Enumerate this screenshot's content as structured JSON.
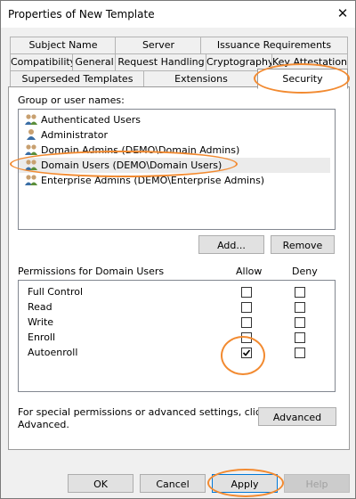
{
  "window": {
    "title": "Properties of New Template",
    "close_glyph": "✕"
  },
  "tabs": {
    "row1": [
      "Subject Name",
      "Server",
      "Issuance Requirements"
    ],
    "row2": [
      "Compatibility",
      "General",
      "Request Handling",
      "Cryptography",
      "Key Attestation"
    ],
    "row3": [
      "Superseded Templates",
      "Extensions",
      "Security"
    ],
    "active": "Security"
  },
  "security": {
    "group_label": "Group or user names:",
    "users": [
      {
        "name": "Authenticated Users",
        "icon": "group-icon"
      },
      {
        "name": "Administrator",
        "icon": "user-icon"
      },
      {
        "name": "Domain Admins (DEMO\\Domain Admins)",
        "icon": "group-icon"
      },
      {
        "name": "Domain Users (DEMO\\Domain Users)",
        "icon": "group-icon",
        "selected": true
      },
      {
        "name": "Enterprise Admins (DEMO\\Enterprise Admins)",
        "icon": "group-icon"
      }
    ],
    "add_label": "Add...",
    "remove_label": "Remove",
    "permissions_label": "Permissions for Domain Users",
    "allow_header": "Allow",
    "deny_header": "Deny",
    "permissions": [
      {
        "name": "Full Control",
        "allow": false,
        "deny": false
      },
      {
        "name": "Read",
        "allow": false,
        "deny": false
      },
      {
        "name": "Write",
        "allow": false,
        "deny": false
      },
      {
        "name": "Enroll",
        "allow": false,
        "deny": false
      },
      {
        "name": "Autoenroll",
        "allow": true,
        "deny": false
      }
    ],
    "special_text_line1": "For special permissions or advanced settings, click",
    "special_text_line2": "Advanced.",
    "advanced_label": "Advanced"
  },
  "footer": {
    "ok_label": "OK",
    "cancel_label": "Cancel",
    "apply_label": "Apply",
    "help_label": "Help"
  },
  "colors": {
    "highlight_oval": "#f28a30",
    "selection": "#ebebeb",
    "window_bg": "#f0f0f0"
  }
}
